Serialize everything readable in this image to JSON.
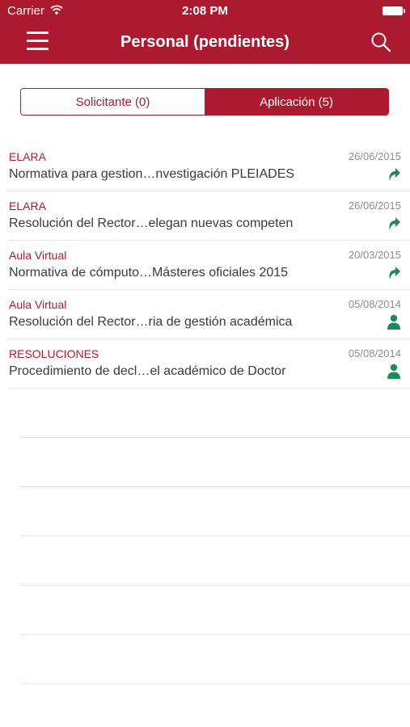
{
  "status_bar": {
    "carrier": "Carrier",
    "time": "2:08 PM"
  },
  "header": {
    "title": "Personal (pendientes)"
  },
  "tabs": [
    {
      "label": "Solicitante (0)",
      "selected": false
    },
    {
      "label": "Aplicación (5)",
      "selected": true
    }
  ],
  "items": [
    {
      "category": "ELARA",
      "date": "26/06/2015",
      "description": "Normativa para gestion…nvestigación PLEIADES",
      "icon": "forward-arrow-icon"
    },
    {
      "category": "ELARA",
      "date": "26/06/2015",
      "description": "Resolución del Rector…elegan nuevas competen",
      "icon": "forward-arrow-icon"
    },
    {
      "category": "Aula Virtual",
      "date": "20/03/2015",
      "description": "Normativa de cómputo…Másteres oficiales 2015",
      "icon": "forward-arrow-icon"
    },
    {
      "category": "Aula Virtual",
      "date": "05/08/2014",
      "description": "Resolución del Rector…ria de gestión académica",
      "icon": "person-icon"
    },
    {
      "category": "RESOLUCIONES",
      "date": "05/08/2014",
      "description": "Procedimiento de decl…el académico de Doctor",
      "icon": "person-icon"
    }
  ],
  "colors": {
    "brand": "#ac1a2f",
    "icon_green": "#1e8a5a",
    "muted_text": "#8e8e8e"
  }
}
